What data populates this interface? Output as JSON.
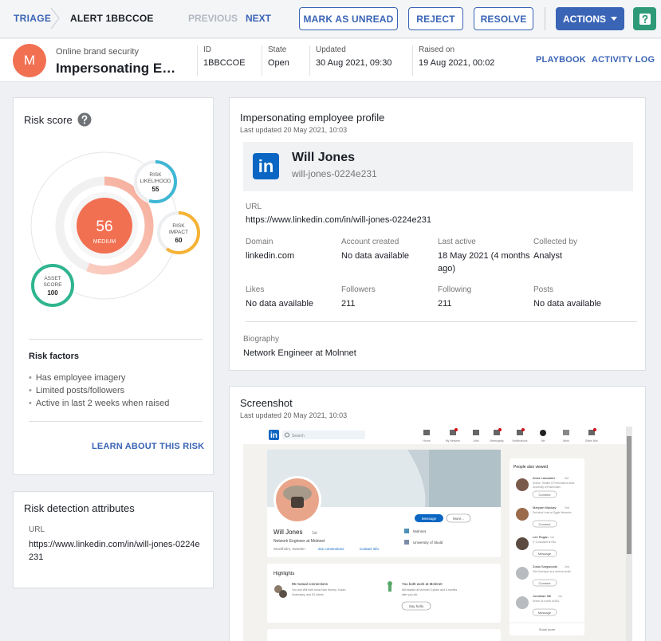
{
  "topbar": {
    "breadcrumb_root": "TRIAGE",
    "breadcrumb_current": "ALERT 1BBCCOE",
    "previous": "PREVIOUS",
    "next": "NEXT",
    "mark_unread": "MARK AS UNREAD",
    "reject": "REJECT",
    "resolve": "RESOLVE",
    "actions": "ACTIONS",
    "help_icon": "question-icon"
  },
  "header": {
    "avatar_letter": "M",
    "subtitle": "Online brand security",
    "title": "Impersonating Employee Profile",
    "id_label": "ID",
    "id_value": "1BBCCOE",
    "state_label": "State",
    "state_value": "Open",
    "updated_label": "Updated",
    "updated_value": "30 Aug 2021, 09:30",
    "raised_label": "Raised on",
    "raised_value": "19 Aug 2021, 00:02",
    "playbook": "PLAYBOOK",
    "activity_log": "ACTIVITY LOG"
  },
  "risk": {
    "title": "Risk score",
    "score": "56",
    "score_level": "MEDIUM",
    "score_fraction": 0.56,
    "likelihood_label_1": "RISK",
    "likelihood_label_2": "LIKELIHOOD",
    "likelihood": "55",
    "likelihood_fraction": 0.55,
    "impact_label_1": "RISK",
    "impact_label_2": "IMPACT",
    "impact": "60",
    "impact_fraction": 0.6,
    "asset_label_1": "ASSET",
    "asset_label_2": "SCORE",
    "asset": "100",
    "asset_fraction": 1.0,
    "colors": {
      "score": "#f27052",
      "likelihood": "#3fb7d4",
      "impact": "#f5b335",
      "asset": "#2fb58f"
    },
    "factors_title": "Risk factors",
    "factors": [
      "Has employee imagery",
      "Limited posts/followers",
      "Active in last 2 weeks when raised"
    ],
    "learn_more": "LEARN ABOUT THIS RISK"
  },
  "detection": {
    "title": "Risk detection attributes",
    "url_label": "URL",
    "url_value": "https://www.linkedin.com/in/will-jones-0224e231"
  },
  "profile": {
    "title": "Impersonating employee profile",
    "updated": "Last updated 20 May 2021, 10:03",
    "logo_text": "in",
    "name": "Will Jones",
    "handle": "will-jones-0224e231",
    "url_label": "URL",
    "url_value": "https://www.linkedin.com/in/will-jones-0224e231",
    "domain_label": "Domain",
    "domain_value": "linkedin.com",
    "created_label": "Account created",
    "created_value": "No data available",
    "active_label": "Last active",
    "active_value_1": "18 May 2021 (4 months",
    "active_value_2": "ago)",
    "collected_label": "Collected by",
    "collected_value": "Analyst",
    "likes_label": "Likes",
    "likes_value": "No data available",
    "followers_label": "Followers",
    "followers_value": "211",
    "following_label": "Following",
    "following_value": "211",
    "posts_label": "Posts",
    "posts_value": "No data available",
    "bio_label": "Biography",
    "bio_value": "Network Engineer at Molnnet"
  },
  "screenshot": {
    "title": "Screenshot",
    "updated": "Last updated 20 May 2021, 10:03",
    "search_placeholder": "Search",
    "nav_items": [
      "Home",
      "My Network",
      "Jobs",
      "Messaging",
      "Notifications",
      "Me",
      "Work",
      "Sales Nav"
    ],
    "profile_name": "Will Jones",
    "degree": "1st",
    "headline": "Network Engineer at Molnnet",
    "location": "Stockholm, Sweden",
    "connections": "211 connections",
    "contact": "Contact info",
    "message_btn": "Message",
    "more_btn": "More...",
    "company": "Molnnet",
    "school": "University of Skuld",
    "highlights": "Highlights",
    "mutual_title": "95 mutual connections",
    "mutual_text_1": "You and Will both know Nick Worley, Suzan",
    "mutual_text_2": "Soderasky, and 93 others",
    "work_title": "You both work at Molnnet",
    "work_text_1": "Will started at Molnnet 3 years and 8 months",
    "work_text_2": "after you did",
    "say_hello": "Say hello",
    "people_title": "People also viewed",
    "people": [
      {
        "name": "Anna Lancaster",
        "degree": "3rd",
        "title_1": "Drama, Theatre & Performance Artist",
        "title_2": "University of Rodersham",
        "action": "Connect"
      },
      {
        "name": "Maryam Mackay",
        "degree": "2nd",
        "title_1": "Technical Lead at Ziggle Networks",
        "title_2": "",
        "action": "Connect"
      },
      {
        "name": "Lee Rogan",
        "degree": "1st",
        "title_1": "IT Consultant at Hiro",
        "title_2": "",
        "action": "Message"
      },
      {
        "name": "Zosia Sargwoods",
        "degree": "2nd",
        "title_1": "Site Developer at a venture studio",
        "title_2": "",
        "action": "Connect"
      },
      {
        "name": "Jonathan Hill",
        "degree": "1st",
        "title_1": "Senior at a work at BDL",
        "title_2": "",
        "action": "Message"
      }
    ],
    "show_more": "Show more"
  }
}
